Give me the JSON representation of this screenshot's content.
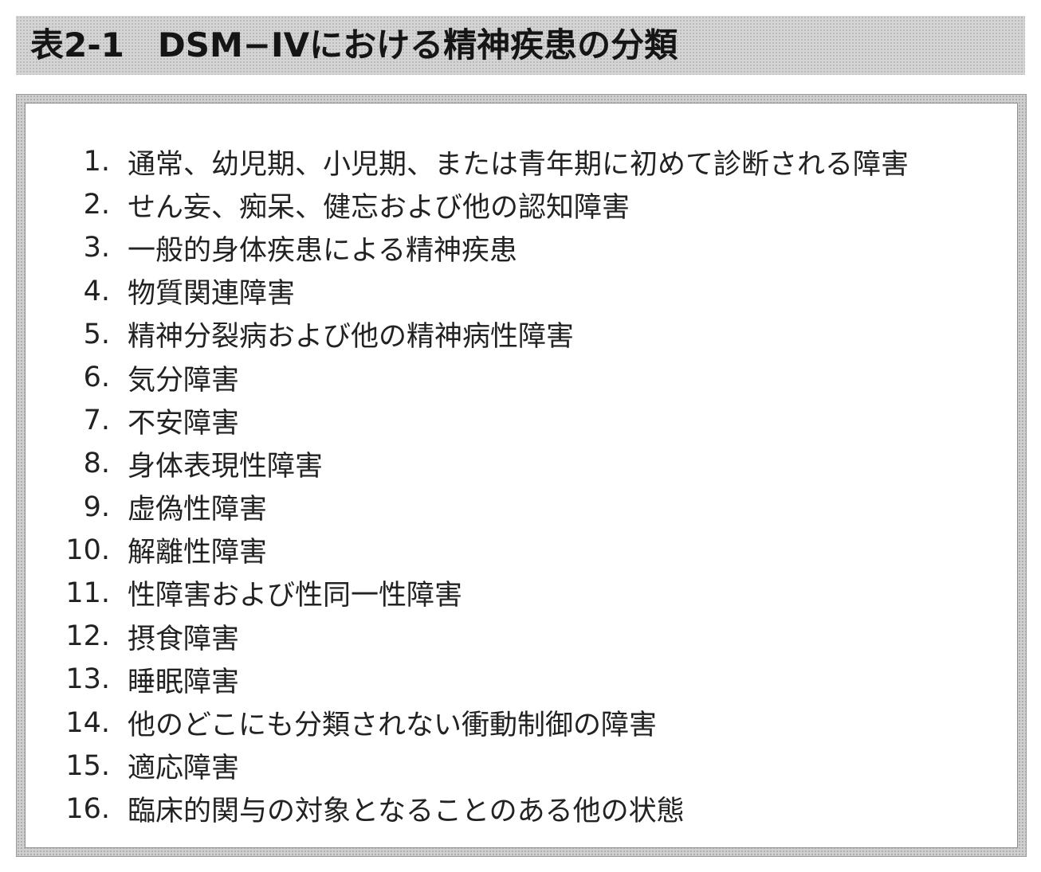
{
  "title": "表2-1　DSM−IVにおける精神疾患の分類",
  "items": [
    {
      "num": "1.",
      "text": "通常、幼児期、小児期、または青年期に初めて診断される障害"
    },
    {
      "num": "2.",
      "text": "せん妄、痴呆、健忘および他の認知障害"
    },
    {
      "num": "3.",
      "text": "一般的身体疾患による精神疾患"
    },
    {
      "num": "4.",
      "text": "物質関連障害"
    },
    {
      "num": "5.",
      "text": "精神分裂病および他の精神病性障害"
    },
    {
      "num": "6.",
      "text": "気分障害"
    },
    {
      "num": "7.",
      "text": "不安障害"
    },
    {
      "num": "8.",
      "text": "身体表現性障害"
    },
    {
      "num": "9.",
      "text": "虚偽性障害"
    },
    {
      "num": "10.",
      "text": "解離性障害"
    },
    {
      "num": "11.",
      "text": "性障害および性同一性障害"
    },
    {
      "num": "12.",
      "text": "摂食障害"
    },
    {
      "num": "13.",
      "text": "睡眠障害"
    },
    {
      "num": "14.",
      "text": "他のどこにも分類されない衝動制御の障害"
    },
    {
      "num": "15.",
      "text": "適応障害"
    },
    {
      "num": "16.",
      "text": "臨床的関与の対象となることのある他の状態"
    }
  ]
}
